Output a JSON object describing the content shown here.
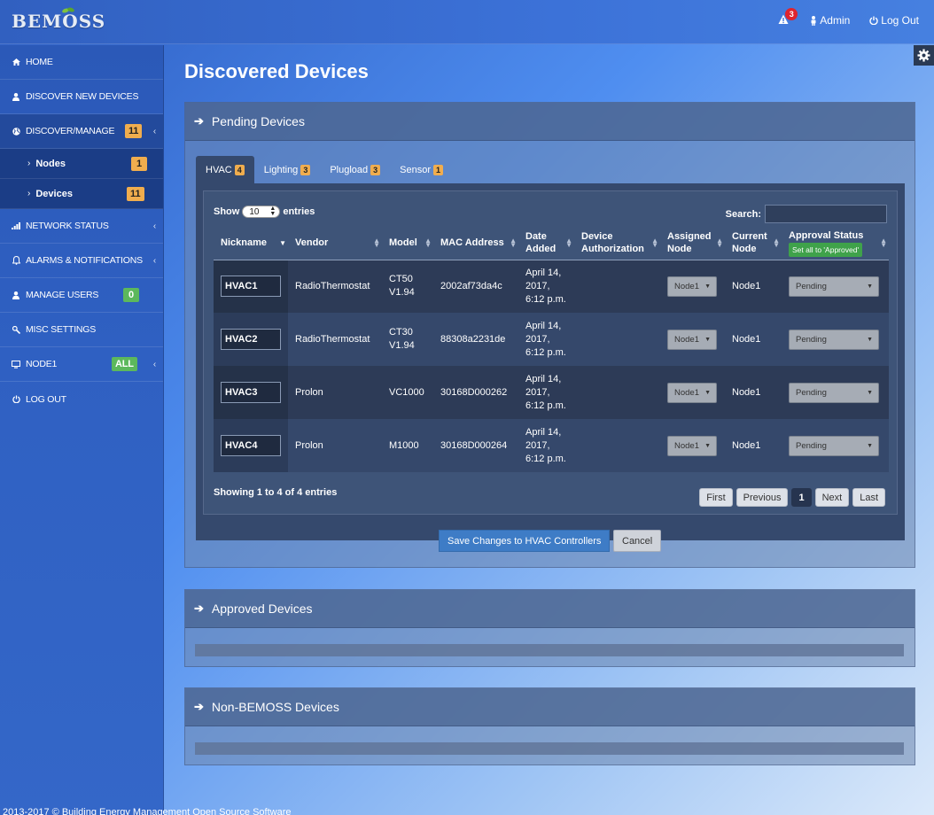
{
  "app": {
    "brand": "BEMOSS",
    "alert_count": "3",
    "user_label": "Admin",
    "logout_label": "Log Out",
    "footer": "2013-2017 © Building Energy Management Open Source Software"
  },
  "sidebar": {
    "items": [
      {
        "label": "HOME",
        "icon": "home-icon"
      },
      {
        "label": "DISCOVER NEW DEVICES",
        "icon": "user-icon"
      },
      {
        "label": "DISCOVER/MANAGE",
        "icon": "globe-icon",
        "badge": "11",
        "badge_color": "#f0ad4e"
      },
      {
        "label": "NETWORK STATUS",
        "icon": "signal-icon"
      },
      {
        "label": "ALARMS & NOTIFICATIONS",
        "icon": "bell-icon"
      },
      {
        "label": "MANAGE USERS",
        "icon": "user-icon",
        "badge": "0",
        "badge_color": "#5cb85c"
      },
      {
        "label": "MISC SETTINGS",
        "icon": "wrench-icon"
      },
      {
        "label": "NODE1",
        "icon": "monitor-icon",
        "badge": "ALL",
        "badge_color": "#5cb85c"
      },
      {
        "label": "LOG OUT",
        "icon": "power-icon"
      }
    ],
    "subitems": [
      {
        "label": "Nodes",
        "badge": "1"
      },
      {
        "label": "Devices",
        "badge": "11"
      }
    ]
  },
  "page": {
    "title": "Discovered Devices"
  },
  "pending": {
    "title": "Pending Devices",
    "tabs": [
      {
        "label": "HVAC",
        "count": "4"
      },
      {
        "label": "Lighting",
        "count": "3"
      },
      {
        "label": "Plugload",
        "count": "3"
      },
      {
        "label": "Sensor",
        "count": "1"
      }
    ],
    "show_label": "Show",
    "show_value": "10",
    "entries_label": "entries",
    "search_label": "Search:",
    "columns": [
      "Nickname",
      "Vendor",
      "Model",
      "MAC Address",
      "Date Added",
      "Device Authorization",
      "Assigned Node",
      "Current Node",
      "Approval Status"
    ],
    "set_all_label": "Set all to 'Approved'",
    "rows": [
      {
        "nickname": "HVAC1",
        "vendor": "RadioThermostat",
        "model": "CT50 V1.94",
        "mac": "2002af73da4c",
        "date": "April 14, 2017, 6:12 p.m.",
        "assigned": "Node1",
        "current": "Node1",
        "status": "Pending"
      },
      {
        "nickname": "HVAC2",
        "vendor": "RadioThermostat",
        "model": "CT30 V1.94",
        "mac": "88308a2231de",
        "date": "April 14, 2017, 6:12 p.m.",
        "assigned": "Node1",
        "current": "Node1",
        "status": "Pending"
      },
      {
        "nickname": "HVAC3",
        "vendor": "Prolon",
        "model": "VC1000",
        "mac": "30168D000262",
        "date": "April 14, 2017, 6:12 p.m.",
        "assigned": "Node1",
        "current": "Node1",
        "status": "Pending"
      },
      {
        "nickname": "HVAC4",
        "vendor": "Prolon",
        "model": "M1000",
        "mac": "30168D000264",
        "date": "April 14, 2017, 6:12 p.m.",
        "assigned": "Node1",
        "current": "Node1",
        "status": "Pending"
      }
    ],
    "info": "Showing 1 to 4 of 4 entries",
    "pager": {
      "first": "First",
      "previous": "Previous",
      "current": "1",
      "next": "Next",
      "last": "Last"
    },
    "save_label": "Save Changes to HVAC Controllers",
    "cancel_label": "Cancel"
  },
  "approved": {
    "title": "Approved Devices"
  },
  "non_bemoss": {
    "title": "Non-BEMOSS Devices"
  }
}
